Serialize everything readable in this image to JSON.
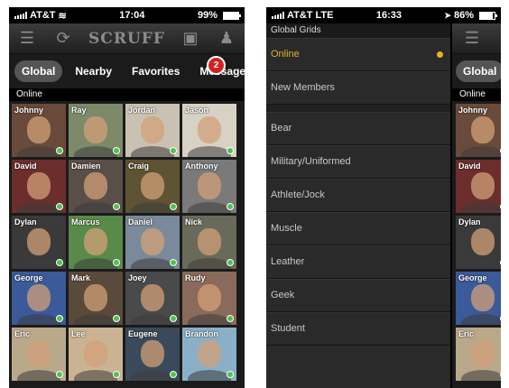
{
  "left_phone": {
    "status": {
      "carrier": "AT&T",
      "signal_icon": "wifi-icon",
      "time": "17:04",
      "battery": "99%",
      "battery_level": 0.99
    },
    "app_name": "SCRUFF",
    "tabs": [
      {
        "label": "Global",
        "active": true
      },
      {
        "label": "Nearby",
        "active": false
      },
      {
        "label": "Favorites",
        "active": false
      },
      {
        "label": "Messages",
        "active": false
      }
    ],
    "messages_badge": "2",
    "section": "Online",
    "profiles": [
      {
        "name": "Johnny",
        "bg": "#6a4a3a"
      },
      {
        "name": "Ray",
        "bg": "#7d8a6a"
      },
      {
        "name": "Jordan",
        "bg": "#c9c2b2"
      },
      {
        "name": "Jason",
        "bg": "#d7d2c4"
      },
      {
        "name": "David",
        "bg": "#6c2d2d"
      },
      {
        "name": "Damien",
        "bg": "#5a4e48"
      },
      {
        "name": "Craig",
        "bg": "#5e5333"
      },
      {
        "name": "Anthony",
        "bg": "#7a7a7a"
      },
      {
        "name": "Dylan",
        "bg": "#3a3a3a"
      },
      {
        "name": "Marcus",
        "bg": "#5a8a4a"
      },
      {
        "name": "Daniel",
        "bg": "#7a8a9a"
      },
      {
        "name": "Nick",
        "bg": "#6a6a5a"
      },
      {
        "name": "George",
        "bg": "#3a5a9a"
      },
      {
        "name": "Mark",
        "bg": "#5a4a3a"
      },
      {
        "name": "Joey",
        "bg": "#4a4a4a"
      },
      {
        "name": "Rudy",
        "bg": "#8a6a5a"
      },
      {
        "name": "Eric",
        "bg": "#b9a98a"
      },
      {
        "name": "Lee",
        "bg": "#c9b392"
      },
      {
        "name": "Eugene",
        "bg": "#3a4a5a"
      },
      {
        "name": "Brandon",
        "bg": "#8ab0c8"
      }
    ]
  },
  "right_phone": {
    "status": {
      "carrier": "AT&T",
      "network": "LTE",
      "time": "16:33",
      "battery": "86%",
      "battery_level": 0.86
    },
    "menu_title": "Global Grids",
    "menu_items": [
      {
        "label": "Online",
        "active": true
      },
      {
        "label": "New Members",
        "active": false
      },
      {
        "label": "Bear",
        "active": false
      },
      {
        "label": "Military/Uniformed",
        "active": false
      },
      {
        "label": "Athlete/Jock",
        "active": false
      },
      {
        "label": "Muscle",
        "active": false
      },
      {
        "label": "Leather",
        "active": false
      },
      {
        "label": "Geek",
        "active": false
      },
      {
        "label": "Student",
        "active": false
      }
    ],
    "peek": {
      "tab": "Global",
      "section": "Online",
      "profiles": [
        {
          "name": "Johnny",
          "bg": "#6a4a3a"
        },
        {
          "name": "David",
          "bg": "#6c2d2d"
        },
        {
          "name": "Dylan",
          "bg": "#3a3a3a"
        },
        {
          "name": "George",
          "bg": "#3a5a9a"
        },
        {
          "name": "Eric",
          "bg": "#b9a98a"
        }
      ]
    }
  },
  "colors": {
    "accent_yellow": "#e3b321",
    "online_green": "#4ec24e",
    "badge_red": "#d12323"
  }
}
